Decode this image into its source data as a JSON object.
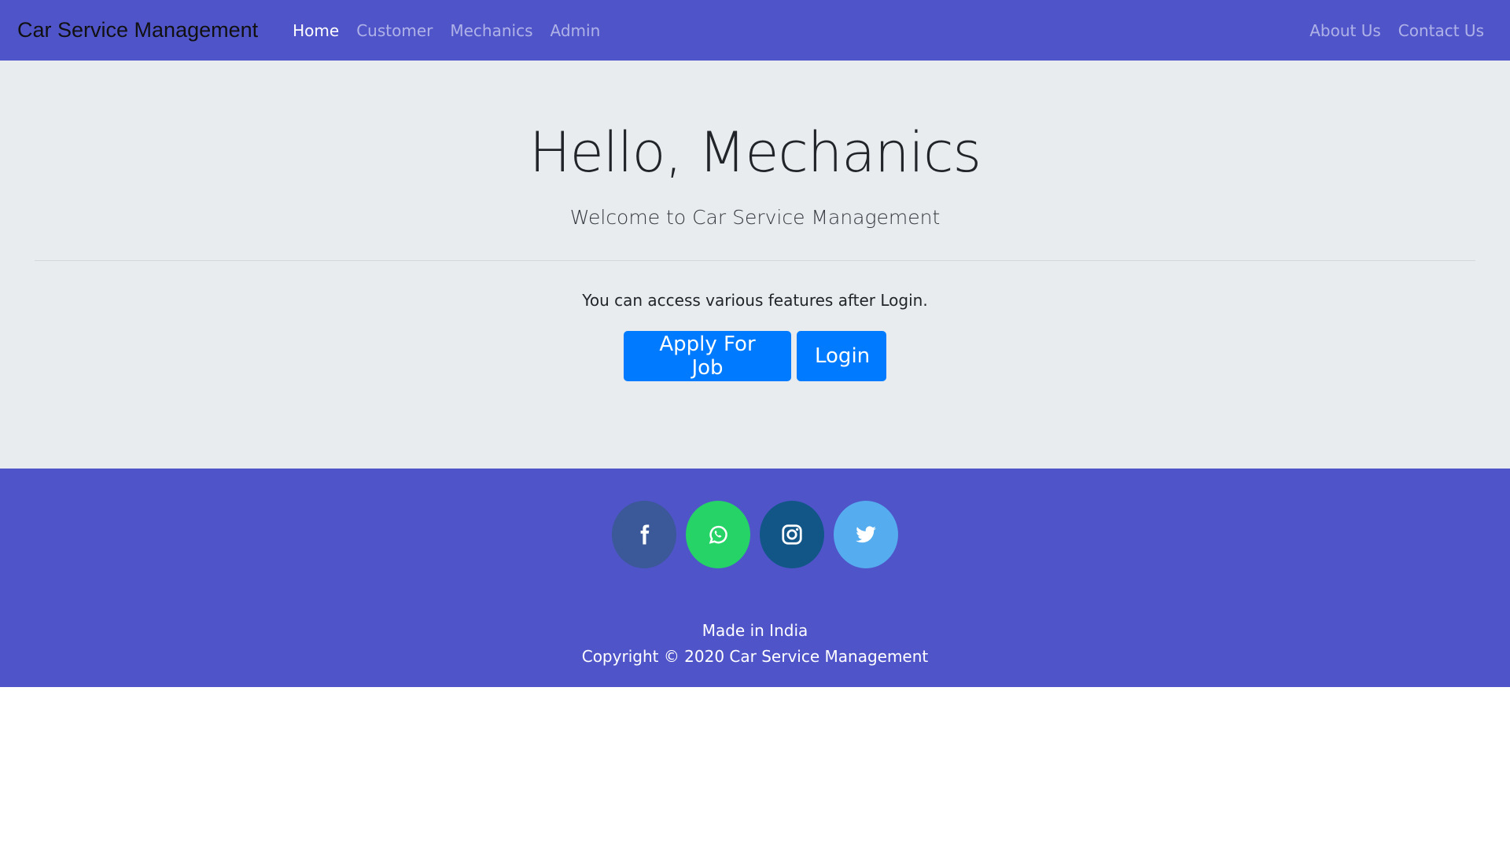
{
  "navbar": {
    "brand": "Car Service Management",
    "left_links": [
      {
        "label": "Home",
        "active": true
      },
      {
        "label": "Customer"
      },
      {
        "label": "Mechanics"
      },
      {
        "label": "Admin"
      }
    ],
    "right_links": [
      {
        "label": "About Us"
      },
      {
        "label": "Contact Us"
      }
    ],
    "background": "#4f54c9"
  },
  "hero": {
    "title": "Hello, Mechanics",
    "subtitle": "Welcome to Car Service Management",
    "note": "You can access various features after Login.",
    "buttons": {
      "apply": "Apply For Job",
      "login": "Login"
    },
    "button_color": "#007bff",
    "background": "#e9ecef"
  },
  "footer": {
    "social": [
      {
        "icon": "facebook-icon",
        "color": "#3b5998"
      },
      {
        "icon": "whatsapp-icon",
        "color": "#25d366"
      },
      {
        "icon": "instagram-icon",
        "color": "#125688"
      },
      {
        "icon": "twitter-icon",
        "color": "#55acee"
      }
    ],
    "made_in": "Made in India",
    "copyright": "Copyright © 2020 Car Service Management",
    "background": "#4f54c9"
  }
}
